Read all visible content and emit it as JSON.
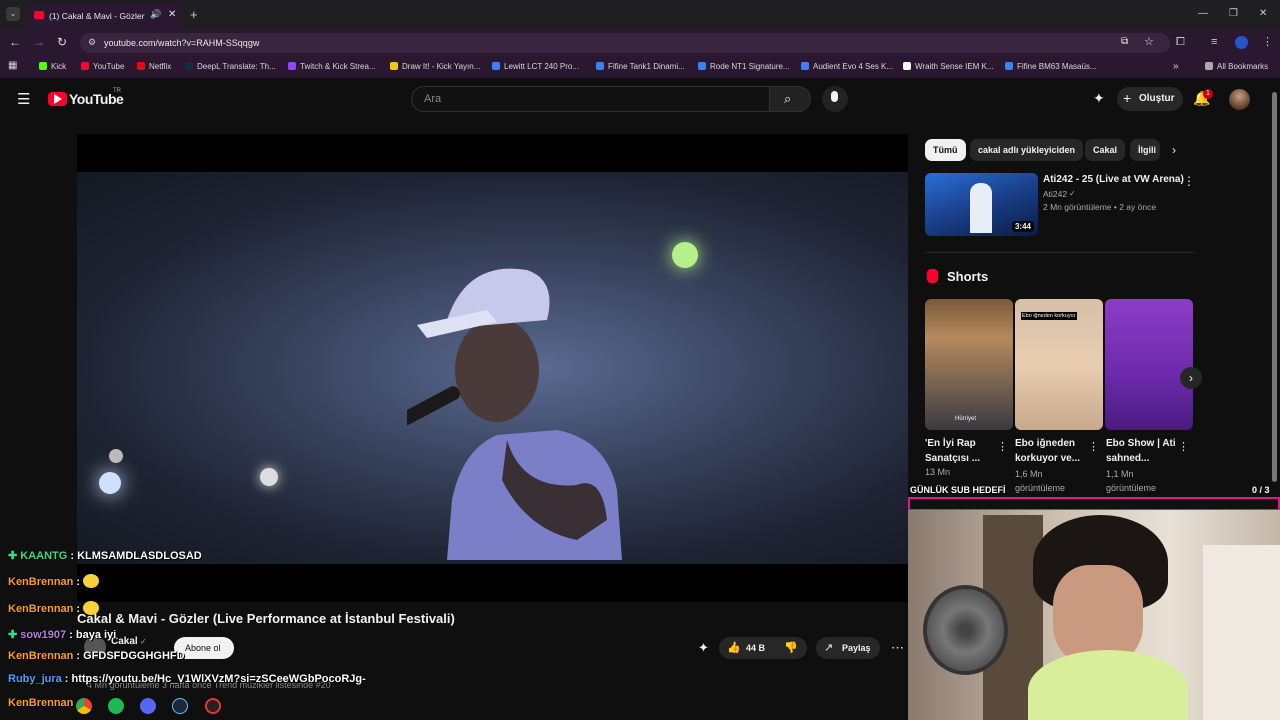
{
  "browser": {
    "tab_title": "(1) Cakal & Mavi - Gözler (L",
    "new_tab": "+",
    "url": "youtube.com/watch?v=RAHM-SSqqgw",
    "bookmarks": [
      {
        "label": "Kick",
        "color": "#53fc18"
      },
      {
        "label": "YouTube",
        "color": "#ff0033"
      },
      {
        "label": "Netflix",
        "color": "#e50914"
      },
      {
        "label": "DeepL Translate: Th...",
        "color": "#0f2b46"
      },
      {
        "label": "Twitch & Kick Strea...",
        "color": "#9146ff"
      },
      {
        "label": "Draw It! - Kick Yayın...",
        "color": "#f0c419"
      },
      {
        "label": "Lewitt LCT 240 Pro...",
        "color": "#3b82f6"
      },
      {
        "label": "Fifine Tank1 Dinami...",
        "color": "#3b82f6"
      },
      {
        "label": "Rode NT1 Signature...",
        "color": "#3b82f6"
      },
      {
        "label": "Audient Evo 4 Ses K...",
        "color": "#3b82f6"
      },
      {
        "label": "Wraith Sense IEM K...",
        "color": "#ffffff"
      },
      {
        "label": "Fifine BM63 Masaüs...",
        "color": "#3b82f6"
      }
    ],
    "all_bookmarks": "All Bookmarks"
  },
  "youtube": {
    "logo": "YouTube",
    "logo_region": "TR",
    "search_placeholder": "Ara",
    "create_label": "Oluştur",
    "notification_count": "1"
  },
  "video": {
    "title": "Cakal & Mavi - Gözler (Live Performance at İstanbul Festivali)",
    "channel": "Cakal",
    "subscribe": "Abone ol",
    "likes": "44 B",
    "share": "Paylaş",
    "meta": "4 Mn görüntüleme  3 hafta önce  Trend müzikler listesinde #20"
  },
  "chips": [
    "Tümü",
    "cakal adlı yükleyiciden",
    "Cakal",
    "İlgili"
  ],
  "recommended": {
    "title": "Ati242 - 25 (Live at VW Arena)",
    "channel": "Ati242",
    "meta": "2 Mn görüntüleme • 2 ay önce",
    "duration": "3:44"
  },
  "shorts": {
    "heading": "Shorts",
    "items": [
      {
        "title": "'En İyi Rap Sanatçısı ...",
        "views": "13 Mn",
        "overlay": "Hürriyet"
      },
      {
        "title": "Ebo iğneden korkuyor ve...",
        "views": "1,6 Mn görüntüleme",
        "overlay": "Ebo iğneden korkuyor"
      },
      {
        "title": "Ebo Show | Ati sahned...",
        "views": "1,1 Mn görüntüleme",
        "overlay": ""
      }
    ]
  },
  "overlay": {
    "goal_label": "GÜNLÜK SUB HEDEFİ",
    "goal_count": "0  / 3",
    "goal_progress": 0.0
  },
  "chat": [
    {
      "user": "KAANTG",
      "color": "#3ddc84",
      "badge": true,
      "text": ": KLMSAMDLASDLOSAD",
      "emote": false
    },
    {
      "user": "KenBrennan",
      "color": "#ff9f1c",
      "badge": false,
      "text": ":",
      "emote": true
    },
    {
      "user": "KenBrennan",
      "color": "#ff9f1c",
      "badge": false,
      "text": ":",
      "emote": true
    },
    {
      "user": "sow1907",
      "color": "#b57edc",
      "badge": true,
      "text": ": baya iyi",
      "emote": false
    },
    {
      "user": "KenBrennan",
      "color": "#ff9f1c",
      "badge": false,
      "text": ": GFDSFDGGHGHFD",
      "emote": false
    },
    {
      "user": "Ruby_jura",
      "color": "#4da3ff",
      "badge": false,
      "text": ": https://youtu.be/Hc_V1WlXVzM?si=zSCeeWGbPocoRJg-",
      "emote": false
    },
    {
      "user": "KenBrennan",
      "color": "#ff9f1c",
      "badge": false,
      "text": "",
      "emote": false
    }
  ]
}
